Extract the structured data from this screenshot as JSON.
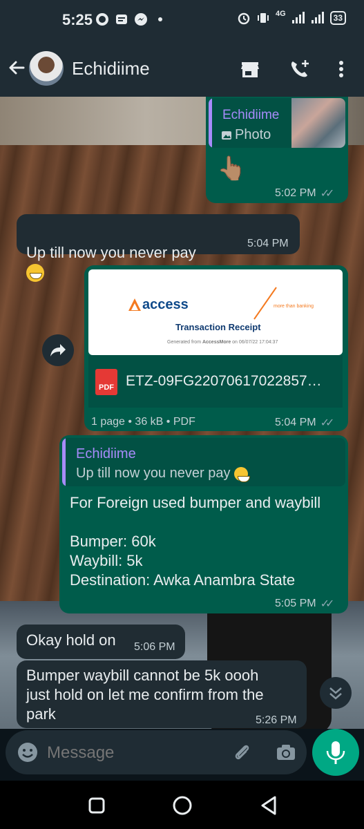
{
  "status_bar": {
    "time": "5:25",
    "network": "4G",
    "battery": "33"
  },
  "header": {
    "contact_name": "Echidiime",
    "icons": [
      "back-arrow-icon",
      "store-icon",
      "add-call-icon",
      "more-vert-icon"
    ]
  },
  "messages": [
    {
      "type": "reply-media",
      "direction": "out",
      "quote_name": "Echidiime",
      "quote_text": "Photo",
      "body_emoji": "👆🏽",
      "time": "5:02 PM"
    },
    {
      "type": "text",
      "direction": "in",
      "text": "Up till now you never pay",
      "time": "5:04 PM"
    },
    {
      "type": "document",
      "direction": "out",
      "preview_brand": "access",
      "preview_title": "Transaction Receipt",
      "preview_tagline": "more than banking",
      "preview_generated_prefix": "Generated from ",
      "preview_generated_app": "AccessMore",
      "preview_generated_suffix": " on 06/07/22 17:04:37",
      "filename": "ETZ-09FG22070617022857…",
      "meta": "1 page • 36 kB • PDF",
      "time": "5:04 PM"
    },
    {
      "type": "reply-text",
      "direction": "out",
      "quote_name": "Echidiime",
      "quote_text": "Up till now you never pay",
      "text": "For Foreign used bumper and waybill\n\nBumper: 60k\nWaybill: 5k\nDestination: Awka Anambra State",
      "time": "5:05 PM"
    },
    {
      "type": "text",
      "direction": "in",
      "text": "Okay hold on",
      "time": "5:06 PM"
    },
    {
      "type": "text",
      "direction": "in",
      "text": "Bumper waybill cannot be 5k oooh\njust hold on let me confirm from the\npark",
      "time": "5:26 PM"
    }
  ],
  "input": {
    "placeholder": "Message"
  },
  "colors": {
    "outgoing_bubble": "#005c4b",
    "incoming_bubble": "#202c33",
    "header": "#1f2c34",
    "accent": "#00a884",
    "quote_name": "#a78bfa"
  }
}
